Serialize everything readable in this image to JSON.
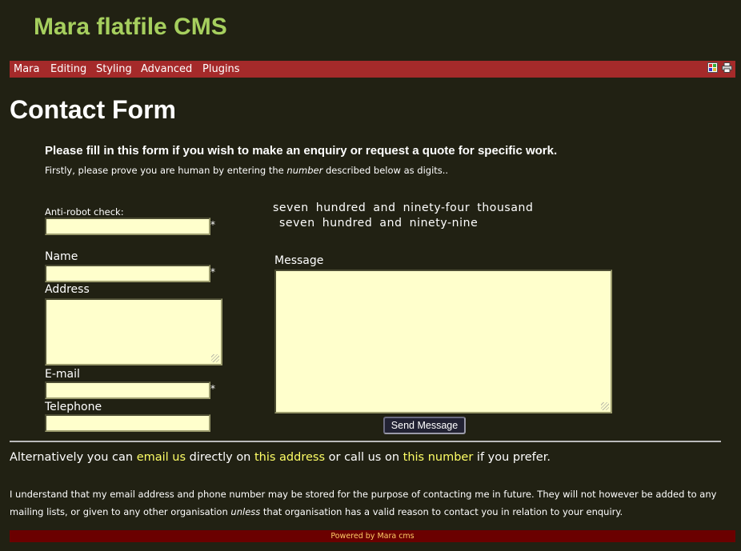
{
  "site": {
    "title": "Mara flatfile CMS"
  },
  "menu": {
    "items": [
      "Mara",
      "Editing",
      "Styling",
      "Advanced",
      "Plugins"
    ],
    "icons": [
      "layout-icon",
      "print-icon"
    ]
  },
  "page": {
    "heading": "Contact Form",
    "intro_strong": "Please fill in this form if you wish to make an enquiry or request a quote for specific work.",
    "intro_before": "Firstly, please prove you are human by entering the ",
    "intro_em": "number",
    "intro_after": " described below as digits.."
  },
  "form": {
    "antirobot_label": "Anti-robot check:",
    "captcha_line1": "seven hundred and ninety-four thousand",
    "captcha_line2": "seven hundred and ninety-nine",
    "name_label": "Name",
    "address_label": "Address",
    "email_label": "E-mail",
    "telephone_label": "Telephone",
    "message_label": "Message",
    "required_marker": "*",
    "send_label": "Send Message"
  },
  "alternative": {
    "part1": "Alternatively you can ",
    "link_email": "email us",
    "part2": " directly on ",
    "link_address": "this address",
    "part3": " or call us on ",
    "link_number": "this number",
    "part4": " if you prefer."
  },
  "consent": {
    "before": "I understand that my email address and phone number may be stored for the purpose of contacting me in future. They will not however be added to any mailing lists, or given to any other organisation ",
    "em": "unless",
    "after": " that organisation has a valid reason to contact you in relation to your enquiry."
  },
  "footer": {
    "text": "Powered by Mara cms"
  },
  "colors": {
    "background": "#212113",
    "title": "#a6cf5e",
    "menubar": "#a52a2a",
    "input_bg": "#ffffcc",
    "link": "#ffff66",
    "footer_bg": "#6b0000"
  }
}
